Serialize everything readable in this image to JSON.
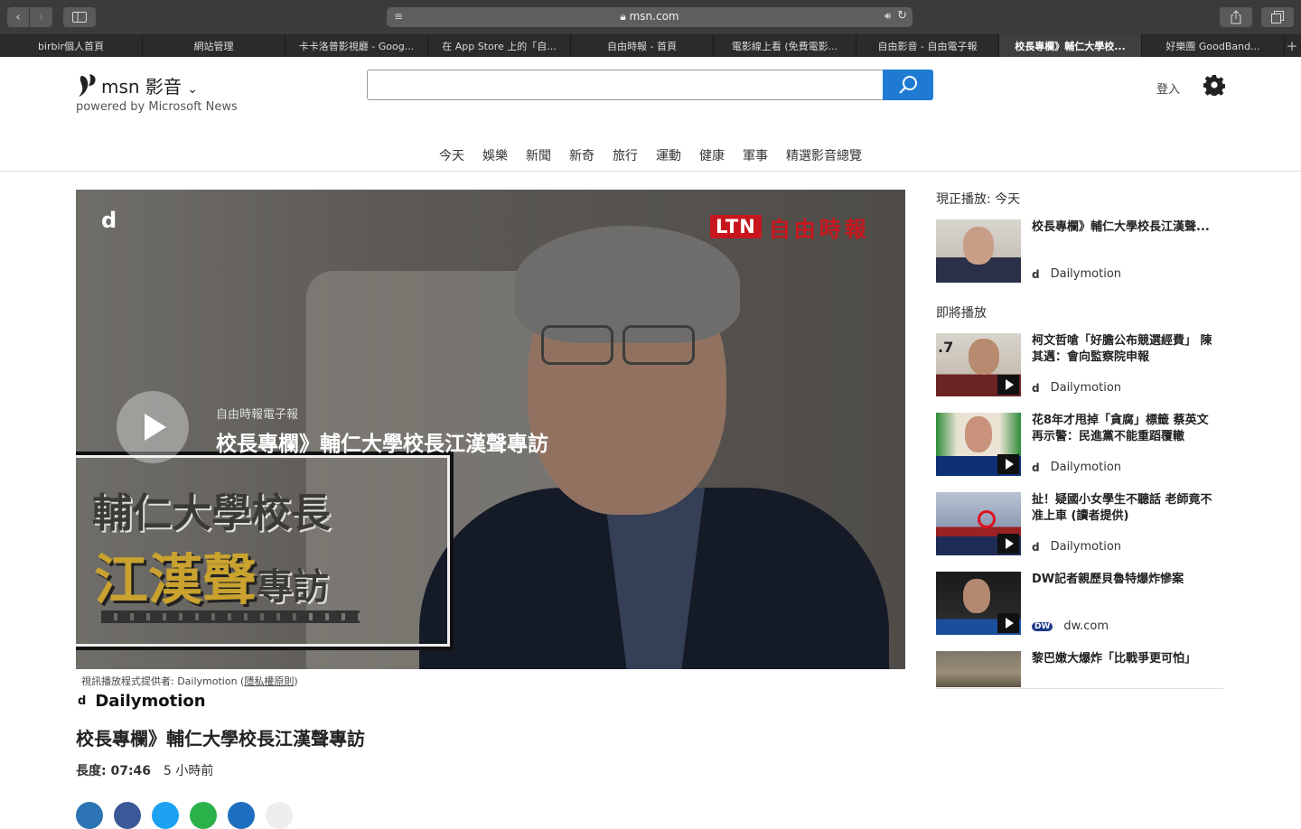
{
  "browser": {
    "url": "msn.com",
    "tabs": [
      {
        "label": "birbir個人首頁"
      },
      {
        "label": "網站管理"
      },
      {
        "label": "卡卡洛普影視廳 - Goog..."
      },
      {
        "label": "在 App Store 上的「自..."
      },
      {
        "label": "自由時報 - 首頁"
      },
      {
        "label": "電影線上看 (免費電影..."
      },
      {
        "label": "自由影音 - 自由電子報"
      },
      {
        "label": "校長專欄》輔仁大學校...",
        "active": true
      },
      {
        "label": "好樂團 GoodBand..."
      }
    ]
  },
  "header": {
    "logo_text": "msn 影音",
    "powered_by": "powered by Microsoft News",
    "search_placeholder": "",
    "signin": "登入"
  },
  "nav": [
    "今天",
    "娛樂",
    "新聞",
    "新奇",
    "旅行",
    "運動",
    "健康",
    "軍事",
    "精選影音總覽"
  ],
  "video": {
    "overlay_source": "自由時報電子報",
    "overlay_title": "校長專欄》輔仁大學校長江漢聲專訪",
    "ltn_badge": "LTN",
    "ltn_name": "自由時報",
    "card_line1": "輔仁大學校長",
    "card_line2": "江漢聲",
    "card_line2_suffix": "專訪",
    "dm_mark": "d"
  },
  "below": {
    "provider_note": "視訊播放程式提供者: Dailymotion (",
    "privacy_link": "隱私權原則",
    "provider_note_end": ")",
    "brand_mark": "d",
    "brand_name": "Dailymotion",
    "title": "校長專欄》輔仁大學校長江漢聲專訪",
    "duration": "長度: 07:46",
    "age": "5 小時前"
  },
  "rail": {
    "now_playing_label": "現正播放: 今天",
    "now_playing": {
      "title": "校長專欄》輔仁大學校長江漢聲...",
      "source": "Dailymotion"
    },
    "upnext_label": "即將播放",
    "items": [
      {
        "title": "柯文哲嗆「好膽公布競選經費」 陳其邁：會向監察院申報",
        "source": "Dailymotion"
      },
      {
        "title": "花8年才甩掉「貪腐」標籤 蔡英文再示警：民進黨不能重蹈覆轍",
        "source": "Dailymotion"
      },
      {
        "title": "扯！疑國小女學生不聽話 老師竟不准上車 (讀者提供)",
        "source": "Dailymotion"
      },
      {
        "title": "DW記者親歷貝魯特爆炸慘案",
        "source": "dw.com"
      },
      {
        "title": "黎巴嫩大爆炸「比戰爭更可怕」",
        "source": ""
      }
    ]
  }
}
